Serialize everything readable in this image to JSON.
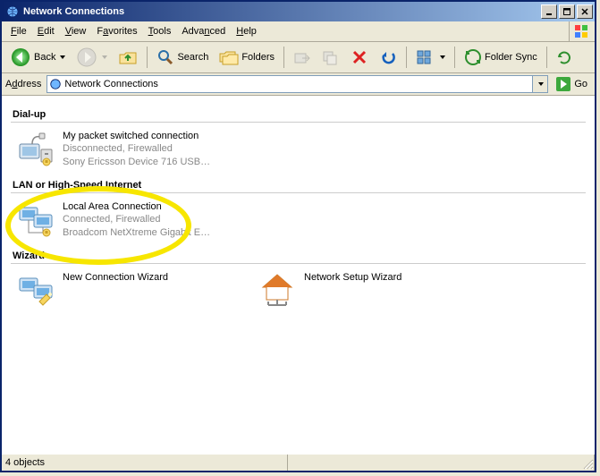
{
  "title": "Network Connections",
  "menus": {
    "file": "File",
    "edit": "Edit",
    "view": "View",
    "favorites": "Favorites",
    "tools": "Tools",
    "advanced": "Advanced",
    "help": "Help"
  },
  "toolbar": {
    "back": "Back",
    "search": "Search",
    "folders": "Folders",
    "foldersync": "Folder Sync"
  },
  "addressbar": {
    "label": "Address",
    "value": "Network Connections",
    "go": "Go"
  },
  "sections": {
    "dialup": {
      "header": "Dial-up",
      "items": [
        {
          "title": "My packet switched connection",
          "status": "Disconnected, Firewalled",
          "device": "Sony Ericsson Device 716 USB…"
        }
      ]
    },
    "lan": {
      "header": "LAN or High-Speed Internet",
      "items": [
        {
          "title": "Local Area Connection",
          "status": "Connected, Firewalled",
          "device": "Broadcom NetXtreme Gigabit E…"
        }
      ]
    },
    "wizard": {
      "header": "Wizard",
      "items": [
        {
          "title": "New Connection Wizard"
        },
        {
          "title": "Network Setup Wizard"
        }
      ]
    }
  },
  "status": "4 objects"
}
